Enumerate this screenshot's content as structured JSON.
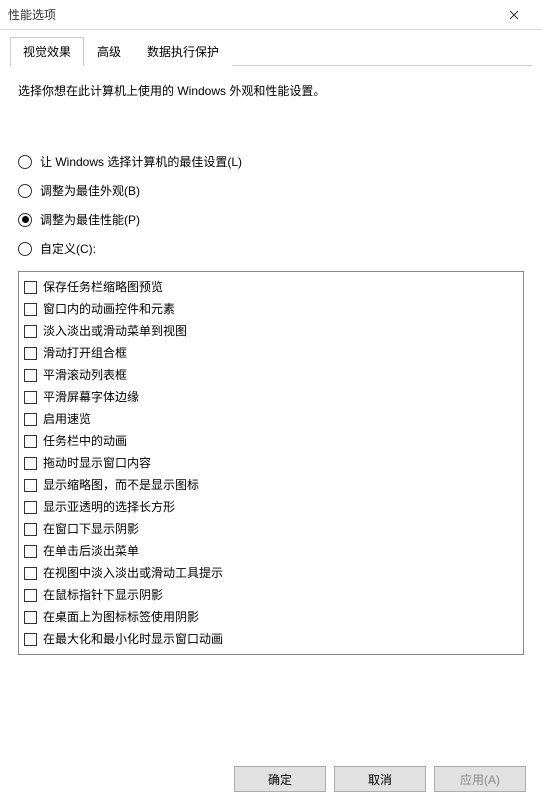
{
  "titlebar": {
    "title": "性能选项"
  },
  "tabs": [
    {
      "label": "视觉效果",
      "active": true
    },
    {
      "label": "高级",
      "active": false
    },
    {
      "label": "数据执行保护",
      "active": false
    }
  ],
  "description": "选择你想在此计算机上使用的 Windows 外观和性能设置。",
  "radios": [
    {
      "label": "让 Windows 选择计算机的最佳设置(L)",
      "checked": false
    },
    {
      "label": "调整为最佳外观(B)",
      "checked": false
    },
    {
      "label": "调整为最佳性能(P)",
      "checked": true
    },
    {
      "label": "自定义(C):",
      "checked": false
    }
  ],
  "checkboxes": [
    {
      "label": "保存任务栏缩略图预览",
      "checked": false
    },
    {
      "label": "窗口内的动画控件和元素",
      "checked": false
    },
    {
      "label": "淡入淡出或滑动菜单到视图",
      "checked": false
    },
    {
      "label": "滑动打开组合框",
      "checked": false
    },
    {
      "label": "平滑滚动列表框",
      "checked": false
    },
    {
      "label": "平滑屏幕字体边缘",
      "checked": false
    },
    {
      "label": "启用速览",
      "checked": false
    },
    {
      "label": "任务栏中的动画",
      "checked": false
    },
    {
      "label": "拖动时显示窗口内容",
      "checked": false
    },
    {
      "label": "显示缩略图，而不是显示图标",
      "checked": false
    },
    {
      "label": "显示亚透明的选择长方形",
      "checked": false
    },
    {
      "label": "在窗口下显示阴影",
      "checked": false
    },
    {
      "label": "在单击后淡出菜单",
      "checked": false
    },
    {
      "label": "在视图中淡入淡出或滑动工具提示",
      "checked": false
    },
    {
      "label": "在鼠标指针下显示阴影",
      "checked": false
    },
    {
      "label": "在桌面上为图标标签使用阴影",
      "checked": false
    },
    {
      "label": "在最大化和最小化时显示窗口动画",
      "checked": false
    }
  ],
  "buttons": {
    "ok": "确定",
    "cancel": "取消",
    "apply": "应用(A)"
  }
}
